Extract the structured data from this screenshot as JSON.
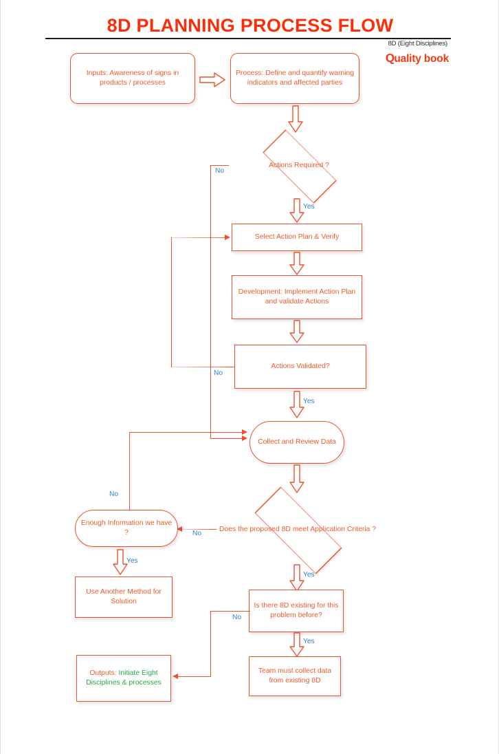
{
  "header": {
    "title": "8D PLANNING PROCESS FLOW",
    "subnote": "8D (Eight Disciplines)",
    "brand_mark": "Q",
    "brand": "uality book"
  },
  "colors": {
    "accent": "#f1512a",
    "title": "#fb2e0a",
    "node_text": "#f05a2a",
    "label_text": "#2f7fd1",
    "output_green": "#2aa84a",
    "rule": "#1a1a1a"
  },
  "nodes": {
    "inputs": "Inputs: Awareness of signs in products / processes",
    "process": "Process: Define and quantify warning indicators and affected parties",
    "actions_required": "Actions Required ?",
    "select_plan": "Select Action Plan & Verify",
    "development": "Development:  Implement Action Plan and validate Actions",
    "actions_validated": "Actions Validated?",
    "collect_review": "Collect and Review Data",
    "meets_criteria": "Does the proposed 8D meet Application Criteria ?",
    "enough_info": "Enough Information we have ?",
    "another_method": "Use Another Method for Solution",
    "existing_8d": "Is there 8D existing for this problem before?",
    "team_collect": "Team must collect data from existing 8D",
    "outputs_prefix": "Outputs:",
    "outputs_body": "Initiate Eight Disciplines & processes"
  },
  "edge_labels": {
    "actions_required_no": "No",
    "actions_required_yes": "Yes",
    "actions_validated_no": "No",
    "actions_validated_yes": "Yes",
    "enough_info_no": "No",
    "enough_info_yes": "Yes",
    "criteria_no": "No",
    "criteria_yes": "Yes",
    "existing_no": "No",
    "existing_yes": "Yes"
  },
  "chart_data": {
    "type": "diagram",
    "diagram_kind": "flowchart",
    "title": "8D PLANNING PROCESS FLOW",
    "orientation": "top-to-bottom",
    "nodes": [
      {
        "id": "inputs",
        "shape": "rounded-rect",
        "text": "Inputs: Awareness of signs in products / processes"
      },
      {
        "id": "process",
        "shape": "rounded-rect",
        "text": "Process: Define and quantify warning indicators and affected parties"
      },
      {
        "id": "actions_required",
        "shape": "diamond",
        "text": "Actions Required ?"
      },
      {
        "id": "select_plan",
        "shape": "rect",
        "text": "Select Action Plan & Verify"
      },
      {
        "id": "development",
        "shape": "rect",
        "text": "Development:  Implement Action Plan and validate Actions"
      },
      {
        "id": "actions_validated",
        "shape": "rect",
        "text": "Actions Validated?"
      },
      {
        "id": "collect_review",
        "shape": "stadium",
        "text": "Collect and Review Data"
      },
      {
        "id": "meets_criteria",
        "shape": "diamond",
        "text": "Does the proposed 8D meet Application Criteria ?"
      },
      {
        "id": "enough_info",
        "shape": "stadium",
        "text": "Enough Information we have ?"
      },
      {
        "id": "another_method",
        "shape": "rect",
        "text": "Use Another Method for Solution"
      },
      {
        "id": "existing_8d",
        "shape": "rect",
        "text": "Is there 8D existing for this problem before?"
      },
      {
        "id": "team_collect",
        "shape": "rect",
        "text": "Team must collect data from existing 8D"
      },
      {
        "id": "outputs",
        "shape": "rect",
        "text": "Outputs: Initiate Eight Disciplines & processes"
      }
    ],
    "edges": [
      {
        "from": "inputs",
        "to": "process",
        "label": ""
      },
      {
        "from": "process",
        "to": "actions_required",
        "label": ""
      },
      {
        "from": "actions_required",
        "to": "select_plan",
        "label": "Yes"
      },
      {
        "from": "actions_required",
        "to": "collect_review",
        "label": "No"
      },
      {
        "from": "select_plan",
        "to": "development",
        "label": ""
      },
      {
        "from": "development",
        "to": "actions_validated",
        "label": ""
      },
      {
        "from": "actions_validated",
        "to": "collect_review",
        "label": "Yes"
      },
      {
        "from": "actions_validated",
        "to": "select_plan",
        "label": "No"
      },
      {
        "from": "collect_review",
        "to": "meets_criteria",
        "label": ""
      },
      {
        "from": "meets_criteria",
        "to": "existing_8d",
        "label": "Yes"
      },
      {
        "from": "meets_criteria",
        "to": "enough_info",
        "label": "No"
      },
      {
        "from": "enough_info",
        "to": "another_method",
        "label": "Yes"
      },
      {
        "from": "enough_info",
        "to": "collect_review",
        "label": "No"
      },
      {
        "from": "existing_8d",
        "to": "team_collect",
        "label": "Yes"
      },
      {
        "from": "existing_8d",
        "to": "outputs",
        "label": "No"
      }
    ]
  }
}
